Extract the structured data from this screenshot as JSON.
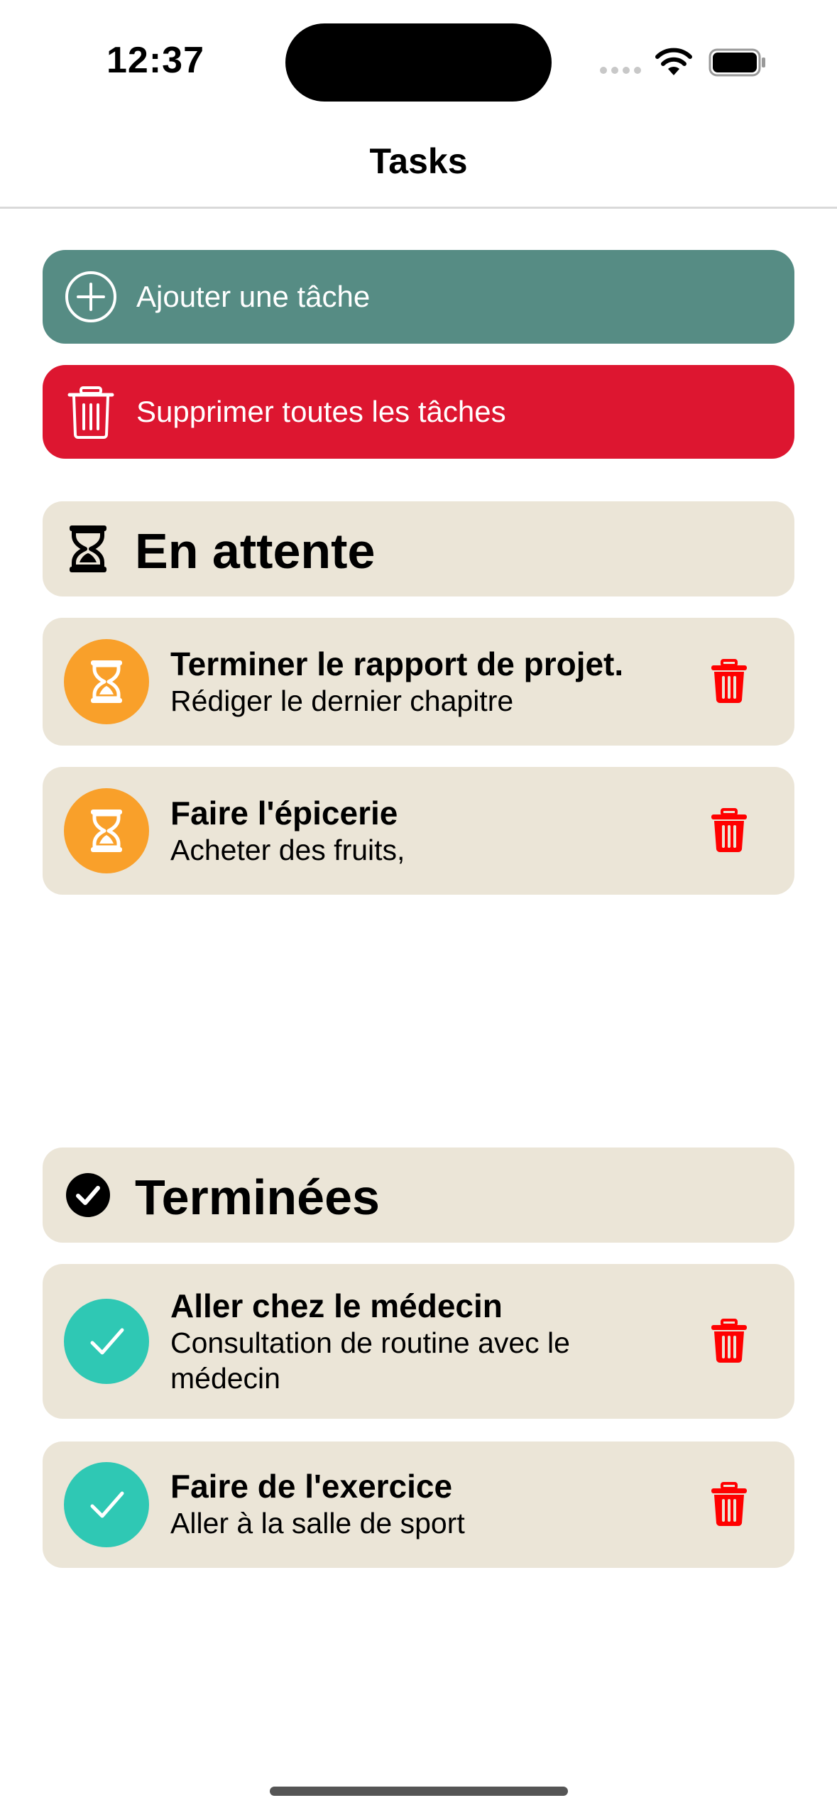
{
  "status_bar": {
    "time": "12:37"
  },
  "nav": {
    "title": "Tasks"
  },
  "actions": {
    "add_label": "Ajouter une tâche",
    "delete_all_label": "Supprimer toutes les tâches"
  },
  "sections": {
    "pending": {
      "title": "En attente",
      "tasks": [
        {
          "title": "Terminer le rapport de projet.",
          "description": "Rédiger le dernier chapitre"
        },
        {
          "title": "Faire l'épicerie",
          "description": "Acheter des fruits,"
        }
      ]
    },
    "done": {
      "title": "Terminées",
      "tasks": [
        {
          "title": "Aller chez le médecin",
          "description": "Consultation de routine avec le médecin"
        },
        {
          "title": "Faire de l'exercice",
          "description": "Aller à la salle de sport"
        }
      ]
    }
  },
  "colors": {
    "add_button": "#568c84",
    "delete_button": "#dd1630",
    "card_background": "#ebe5d7",
    "pending_badge": "#f9a02a",
    "done_badge": "#2fc8b4",
    "trash_icon": "#ff0000"
  },
  "icons": {
    "add": "plus-circle-icon",
    "delete_all": "trash-icon",
    "pending_section": "hourglass-icon",
    "done_section": "checkmark-circle-icon",
    "pending_task": "hourglass-icon",
    "done_task": "checkmark-icon",
    "task_delete": "trash-icon"
  }
}
